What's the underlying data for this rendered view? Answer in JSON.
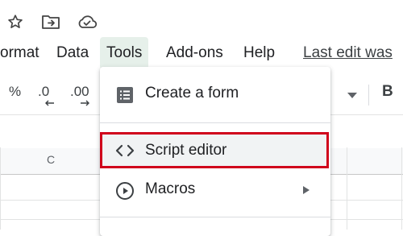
{
  "menubar": {
    "items": [
      "ormat",
      "Data",
      "Tools",
      "Add-ons",
      "Help"
    ],
    "active": "Tools",
    "last_edit": "Last edit was"
  },
  "toolbar": {
    "percent": "%",
    "decrease_decimals": ".0",
    "increase_decimals": ".00",
    "bold": "B"
  },
  "grid": {
    "column_c": "C"
  },
  "tools_menu": {
    "items": [
      {
        "label": "Create a form",
        "icon": "form-icon"
      },
      {
        "label": "Script editor",
        "icon": "code-icon",
        "highlighted": true
      },
      {
        "label": "Macros",
        "icon": "play-circle-icon",
        "has_submenu": true
      }
    ]
  },
  "colors": {
    "highlight_border": "#d0021b",
    "active_menu_bg": "#e6f0ea"
  }
}
